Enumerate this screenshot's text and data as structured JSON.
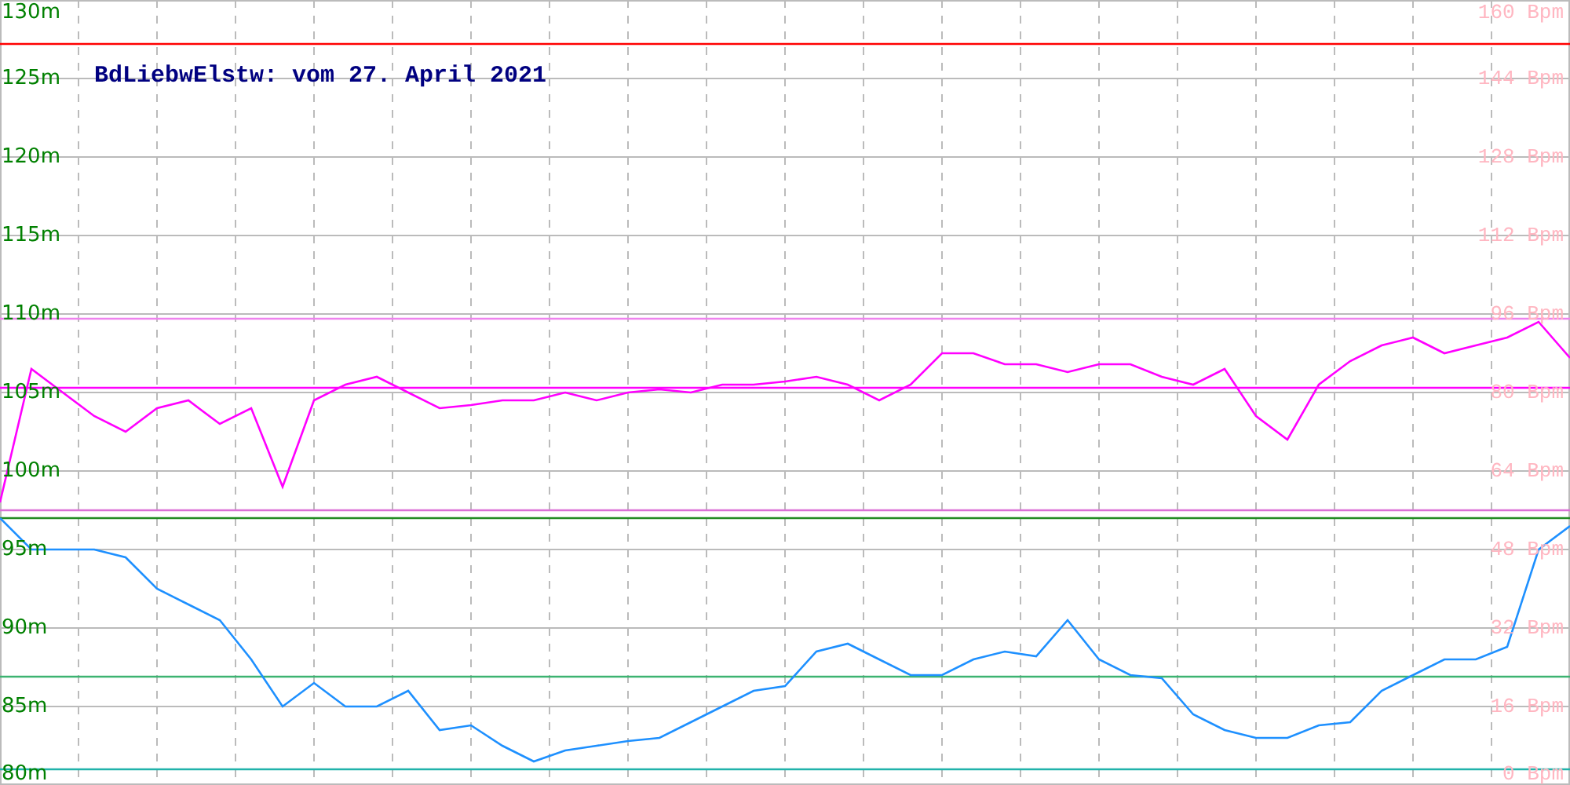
{
  "chart_data": {
    "type": "line",
    "title": "BdLiebwElstw: vom 27. April 2021",
    "categories": [
      null,
      null,
      null,
      null,
      null,
      null,
      null,
      null,
      null,
      null,
      null,
      null,
      null,
      null,
      null,
      null,
      null,
      null,
      null,
      null,
      null,
      null,
      null,
      null,
      null,
      null,
      null,
      null,
      null,
      null,
      null,
      null,
      null,
      null,
      null,
      null,
      null,
      null,
      null,
      null,
      null,
      null,
      null,
      null,
      null,
      null,
      null,
      null,
      null,
      null,
      null
    ],
    "series": [
      {
        "color": "#ff0000",
        "values": [
          127.2,
          127.2,
          127.2,
          127.2,
          127.2,
          127.2,
          127.2,
          127.2,
          127.2,
          127.2,
          127.2,
          127.2,
          127.2,
          127.2,
          127.2,
          127.2,
          127.2,
          127.2,
          127.2,
          127.2,
          127.2,
          127.2,
          127.2,
          127.2,
          127.2,
          127.2,
          127.2,
          127.2,
          127.2,
          127.2,
          127.2,
          127.2,
          127.2,
          127.2,
          127.2,
          127.2,
          127.2,
          127.2,
          127.2,
          127.2,
          127.2,
          127.2,
          127.2,
          127.2,
          127.2,
          127.2,
          127.2,
          127.2,
          127.2,
          127.2,
          127.2
        ]
      },
      {
        "color": "#ee82ee",
        "values": [
          109.7,
          109.7,
          109.7,
          109.7,
          109.7,
          109.7,
          109.7,
          109.7,
          109.7,
          109.7,
          109.7,
          109.7,
          109.7,
          109.7,
          109.7,
          109.7,
          109.7,
          109.7,
          109.7,
          109.7,
          109.7,
          109.7,
          109.7,
          109.7,
          109.7,
          109.7,
          109.7,
          109.7,
          109.7,
          109.7,
          109.7,
          109.7,
          109.7,
          109.7,
          109.7,
          109.7,
          109.7,
          109.7,
          109.7,
          109.7,
          109.7,
          109.7,
          109.7,
          109.7,
          109.7,
          109.7,
          109.7,
          109.7,
          109.7,
          109.7,
          109.7
        ]
      },
      {
        "color": "#ff00ff",
        "values": [
          105.3,
          105.3,
          105.3,
          105.3,
          105.3,
          105.3,
          105.3,
          105.3,
          105.3,
          105.3,
          105.3,
          105.3,
          105.3,
          105.3,
          105.3,
          105.3,
          105.3,
          105.3,
          105.3,
          105.3,
          105.3,
          105.3,
          105.3,
          105.3,
          105.3,
          105.3,
          105.3,
          105.3,
          105.3,
          105.3,
          105.3,
          105.3,
          105.3,
          105.3,
          105.3,
          105.3,
          105.3,
          105.3,
          105.3,
          105.3,
          105.3,
          105.3,
          105.3,
          105.3,
          105.3,
          105.3,
          105.3,
          105.3,
          105.3,
          105.3,
          105.3
        ]
      },
      {
        "color": "#da70d6",
        "values": [
          97.5,
          97.5,
          97.5,
          97.5,
          97.5,
          97.5,
          97.5,
          97.5,
          97.5,
          97.5,
          97.5,
          97.5,
          97.5,
          97.5,
          97.5,
          97.5,
          97.5,
          97.5,
          97.5,
          97.5,
          97.5,
          97.5,
          97.5,
          97.5,
          97.5,
          97.5,
          97.5,
          97.5,
          97.5,
          97.5,
          97.5,
          97.5,
          97.5,
          97.5,
          97.5,
          97.5,
          97.5,
          97.5,
          97.5,
          97.5,
          97.5,
          97.5,
          97.5,
          97.5,
          97.5,
          97.5,
          97.5,
          97.5,
          97.5,
          97.5,
          97.5
        ]
      },
      {
        "color": "#228b22",
        "values": [
          97,
          97,
          97,
          97,
          97,
          97,
          97,
          97,
          97,
          97,
          97,
          97,
          97,
          97,
          97,
          97,
          97,
          97,
          97,
          97,
          97,
          97,
          97,
          97,
          97,
          97,
          97,
          97,
          97,
          97,
          97,
          97,
          97,
          97,
          97,
          97,
          97,
          97,
          97,
          97,
          97,
          97,
          97,
          97,
          97,
          97,
          97,
          97,
          97,
          97,
          97
        ]
      },
      {
        "color": "#3cb371",
        "values": [
          86.9,
          86.9,
          86.9,
          86.9,
          86.9,
          86.9,
          86.9,
          86.9,
          86.9,
          86.9,
          86.9,
          86.9,
          86.9,
          86.9,
          86.9,
          86.9,
          86.9,
          86.9,
          86.9,
          86.9,
          86.9,
          86.9,
          86.9,
          86.9,
          86.9,
          86.9,
          86.9,
          86.9,
          86.9,
          86.9,
          86.9,
          86.9,
          86.9,
          86.9,
          86.9,
          86.9,
          86.9,
          86.9,
          86.9,
          86.9,
          86.9,
          86.9,
          86.9,
          86.9,
          86.9,
          86.9,
          86.9,
          86.9,
          86.9,
          86.9,
          86.9
        ]
      },
      {
        "color": "#20b2aa",
        "values": [
          81,
          81,
          81,
          81,
          81,
          81,
          81,
          81,
          81,
          81,
          81,
          81,
          81,
          81,
          81,
          81,
          81,
          81,
          81,
          81,
          81,
          81,
          81,
          81,
          81,
          81,
          81,
          81,
          81,
          81,
          81,
          81,
          81,
          81,
          81,
          81,
          81,
          81,
          81,
          81,
          81,
          81,
          81,
          81,
          81,
          81,
          81,
          81,
          81,
          81,
          81
        ]
      },
      {
        "color": "#ff00ff",
        "values": [
          98.0,
          106.5,
          105,
          103.5,
          102.5,
          104,
          104.5,
          103,
          104,
          99,
          104.5,
          105.5,
          106,
          105,
          104,
          104.2,
          104.5,
          104.5,
          105,
          104.5,
          105,
          105.2,
          105,
          105.5,
          105.5,
          105.7,
          106,
          105.5,
          104.5,
          105.5,
          107.5,
          107.5,
          106.8,
          106.8,
          106.3,
          106.8,
          106.8,
          106,
          105.5,
          106.5,
          103.5,
          102,
          105.5,
          107,
          108,
          108.5,
          107.5,
          108,
          108.5,
          109.5,
          107.2
        ]
      },
      {
        "color": "#1e90ff",
        "values": [
          97,
          95,
          95,
          95,
          94.5,
          92.5,
          91.5,
          90.5,
          88,
          85,
          86.5,
          85,
          85,
          86,
          83.5,
          83.8,
          82.5,
          81.5,
          82.2,
          82.5,
          82.8,
          83,
          84,
          85,
          86,
          86.3,
          88.5,
          89,
          88,
          87,
          87,
          88,
          88.5,
          88.2,
          90.5,
          88,
          87,
          86.8,
          84.5,
          83.5,
          83,
          83,
          83.8,
          84,
          86,
          87,
          88,
          88,
          88.8,
          95,
          96.5
        ]
      }
    ],
    "ylim": [
      80,
      130
    ],
    "yticks": [
      {
        "value": 130,
        "label": "130m"
      },
      {
        "value": 125,
        "label": "125m"
      },
      {
        "value": 120,
        "label": "120m"
      },
      {
        "value": 115,
        "label": "115m"
      },
      {
        "value": 110,
        "label": "110m"
      },
      {
        "value": 105,
        "label": "105m"
      },
      {
        "value": 100,
        "label": "100m"
      },
      {
        "value": 95,
        "label": "95m"
      },
      {
        "value": 90,
        "label": "90m"
      },
      {
        "value": 85,
        "label": "85m"
      },
      {
        "value": 80,
        "label": "80m"
      }
    ],
    "grid": true
  },
  "right_axis_labels": [
    "160 Bpm",
    "144 Bpm",
    "128 Bpm",
    "112 Bpm",
    "96 Bpm",
    "80 Bpm",
    "64 Bpm",
    "48 Bpm",
    "32 Bpm",
    "16 Bpm",
    "0 Bpm"
  ]
}
